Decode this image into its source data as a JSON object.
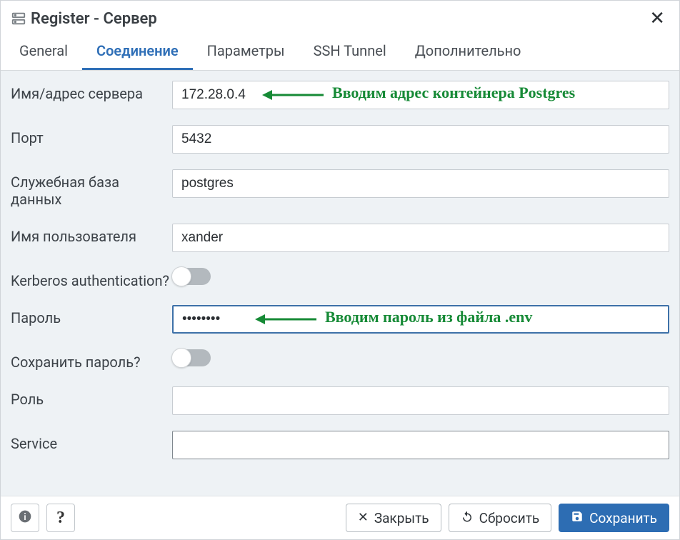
{
  "header": {
    "title": "Register - Сервер"
  },
  "tabs": [
    {
      "label": "General",
      "active": false
    },
    {
      "label": "Соединение",
      "active": true
    },
    {
      "label": "Параметры",
      "active": false
    },
    {
      "label": "SSH Tunnel",
      "active": false
    },
    {
      "label": "Дополнительно",
      "active": false
    }
  ],
  "form": {
    "host_label": "Имя/адрес сервера",
    "host_value": "172.28.0.4",
    "port_label": "Порт",
    "port_value": "5432",
    "maintdb_label": "Служебная база данных",
    "maintdb_value": "postgres",
    "user_label": "Имя пользователя",
    "user_value": "xander",
    "kerberos_label": "Kerberos authentication?",
    "kerberos_on": false,
    "password_label": "Пароль",
    "password_value": "••••••••",
    "savepwd_label": "Сохранить пароль?",
    "savepwd_on": false,
    "role_label": "Роль",
    "role_value": "",
    "service_label": "Service",
    "service_value": ""
  },
  "annotations": {
    "host": "Вводим адрес контейнера Postgres",
    "password": "Вводим пароль из файла .env"
  },
  "footer": {
    "close_label": "Закрыть",
    "reset_label": "Сбросить",
    "save_label": "Сохранить"
  },
  "icons": {
    "server": "server-icon",
    "close": "close-icon",
    "info": "info-icon",
    "help": "help-icon",
    "x": "x-icon",
    "reset": "reset-icon",
    "save": "save-icon"
  },
  "colors": {
    "accent": "#2f6fb7",
    "annotation": "#168a36",
    "primary_btn": "#2d6db3"
  }
}
